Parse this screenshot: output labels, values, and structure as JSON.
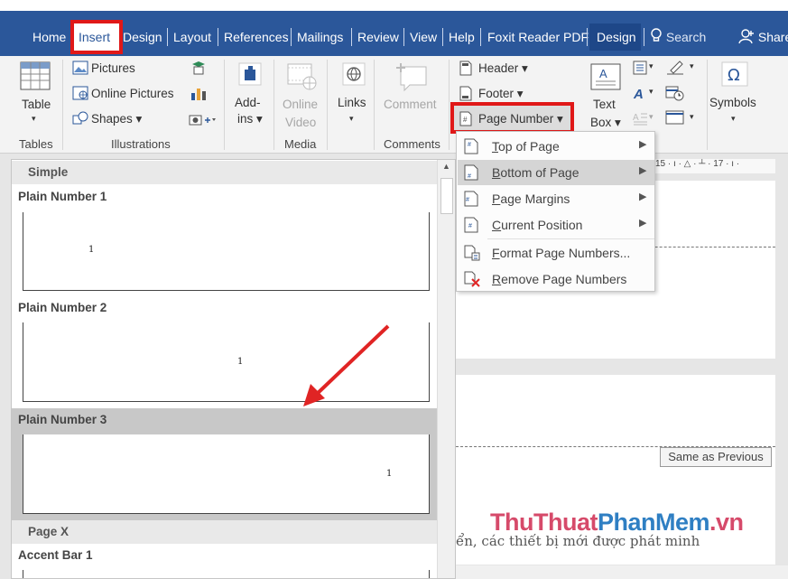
{
  "tabs": {
    "home": "Home",
    "insert": "Insert",
    "design": "Design",
    "layout": "Layout",
    "references": "References",
    "mailings": "Mailings",
    "review": "Review",
    "view": "View",
    "help": "Help",
    "foxit": "Foxit Reader PDF",
    "design2": "Design",
    "search": "Search",
    "share": "Share"
  },
  "ribbon": {
    "table": "Table",
    "pictures": "Pictures",
    "online_pictures": "Online Pictures",
    "shapes": "Shapes",
    "addins_1": "Add-",
    "addins_2": "ins",
    "online_video_1": "Online",
    "online_video_2": "Video",
    "links": "Links",
    "comment": "Comment",
    "header": "Header",
    "footer": "Footer",
    "page_number": "Page Number",
    "textbox_1": "Text",
    "textbox_2": "Box",
    "symbols": "Symbols",
    "groups": {
      "tables": "Tables",
      "illustrations": "Illustrations",
      "media": "Media",
      "comments": "Comments"
    }
  },
  "menu": {
    "items": [
      {
        "label_u": "T",
        "label_rest": "op of Page"
      },
      {
        "label_u": "B",
        "label_rest": "ottom of Page"
      },
      {
        "label_u": "P",
        "label_rest": "age Margins"
      },
      {
        "label_u": "C",
        "label_rest": "urrent Position"
      },
      {
        "label_u": "F",
        "label_rest": "ormat Page Numbers..."
      },
      {
        "label_u": "R",
        "label_rest": "emove Page Numbers"
      }
    ]
  },
  "gallery": {
    "section_simple": "Simple",
    "items": [
      "Plain Number 1",
      "Plain Number 2",
      "Plain Number 3"
    ],
    "page_num": "1",
    "section_pagex": "Page X",
    "accent_bar": "Accent Bar 1"
  },
  "document": {
    "same_as_previous": "Same as Previous",
    "ruler": "15 · ı · △ · ┴ · 17 · ı ·",
    "body_text": "ển, các thiết bị mới được phát minh",
    "watermark_a": "ThuThuat",
    "watermark_b": "PhanMem",
    "watermark_c": ".vn"
  },
  "colors": {
    "accent_blue": "#2b579a",
    "highlight_red": "#e01818",
    "arrow_red": "#e02424"
  }
}
